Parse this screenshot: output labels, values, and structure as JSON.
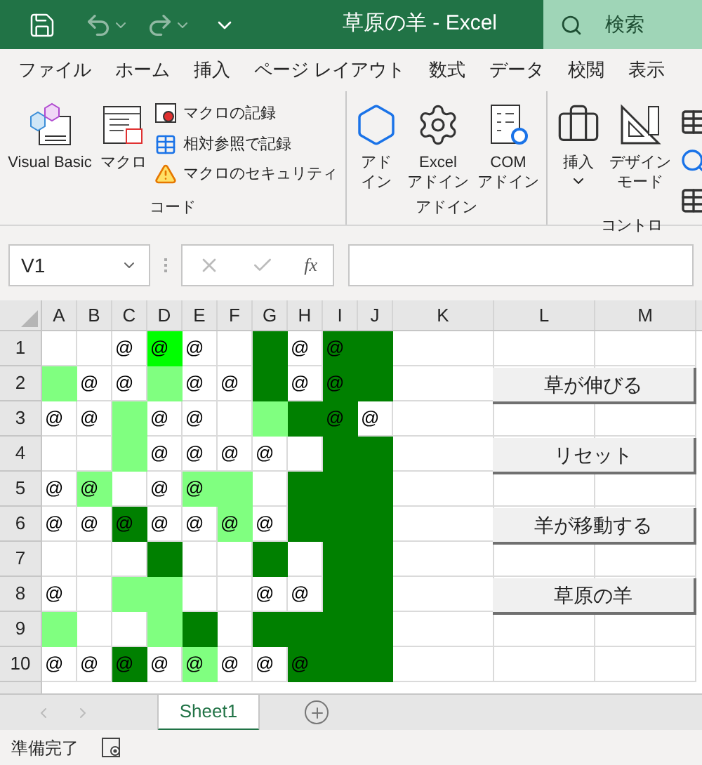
{
  "title_bar": {
    "title": "草原の羊  -  Excel",
    "search": "検索"
  },
  "menu_tabs": [
    "ファイル",
    "ホーム",
    "挿入",
    "ページ レイアウト",
    "数式",
    "データ",
    "校閲",
    "表示"
  ],
  "ribbon_groups": [
    {
      "label": "コード",
      "items": [
        {
          "kind": "large",
          "lines": [
            "Visual Basic"
          ]
        },
        {
          "kind": "large",
          "lines": [
            "マクロ"
          ]
        },
        {
          "kind": "small",
          "lines": [
            "マクロの記録"
          ]
        },
        {
          "kind": "small",
          "lines": [
            "相対参照で記録"
          ]
        },
        {
          "kind": "small",
          "lines": [
            "マクロのセキュリティ"
          ]
        }
      ]
    },
    {
      "label": "アドイン",
      "items": [
        {
          "kind": "large",
          "lines": [
            "アド",
            "イン"
          ]
        },
        {
          "kind": "large",
          "lines": [
            "Excel",
            "アドイン"
          ]
        },
        {
          "kind": "large",
          "lines": [
            "COM",
            "アドイン"
          ]
        }
      ]
    },
    {
      "label": "コントロ",
      "items": [
        {
          "kind": "dropdown",
          "lines": [
            "挿入"
          ]
        },
        {
          "kind": "large",
          "lines": [
            "デザイン",
            "モード"
          ]
        },
        {
          "kind": "stack"
        }
      ]
    }
  ],
  "formula_bar": {
    "name_box": "V1",
    "fx": "fx"
  },
  "columns": [
    "A",
    "B",
    "C",
    "D",
    "E",
    "F",
    "G",
    "H",
    "I",
    "J",
    "K",
    "L",
    "M"
  ],
  "rows": [
    {
      "label": "1",
      "cells": [
        {
          "color": "#ffffff"
        },
        {
          "color": "#ffffff"
        },
        {
          "color": "#ffffff",
          "text": "@"
        },
        {
          "color": "#00ff00",
          "text": "@"
        },
        {
          "color": "#ffffff",
          "text": "@"
        },
        {
          "color": "#ffffff"
        },
        {
          "color": "#008000"
        },
        {
          "color": "#ffffff",
          "text": "@"
        },
        {
          "color": "#008000",
          "text": "@"
        },
        {
          "color": "#008000"
        }
      ]
    },
    {
      "label": "2",
      "cells": [
        {
          "color": "#80ff80"
        },
        {
          "color": "#ffffff",
          "text": "@"
        },
        {
          "color": "#ffffff",
          "text": "@"
        },
        {
          "color": "#80ff80"
        },
        {
          "color": "#ffffff",
          "text": "@"
        },
        {
          "color": "#ffffff",
          "text": "@"
        },
        {
          "color": "#008000"
        },
        {
          "color": "#ffffff",
          "text": "@"
        },
        {
          "color": "#008000",
          "text": "@"
        },
        {
          "color": "#008000"
        }
      ]
    },
    {
      "label": "3",
      "cells": [
        {
          "color": "#ffffff",
          "text": "@"
        },
        {
          "color": "#ffffff",
          "text": "@"
        },
        {
          "color": "#80ff80"
        },
        {
          "color": "#ffffff",
          "text": "@"
        },
        {
          "color": "#ffffff",
          "text": "@"
        },
        {
          "color": "#ffffff"
        },
        {
          "color": "#80ff80"
        },
        {
          "color": "#008000"
        },
        {
          "color": "#008000",
          "text": "@"
        },
        {
          "color": "#ffffff",
          "text": "@"
        }
      ]
    },
    {
      "label": "4",
      "cells": [
        {
          "color": "#ffffff"
        },
        {
          "color": "#ffffff"
        },
        {
          "color": "#80ff80"
        },
        {
          "color": "#ffffff",
          "text": "@"
        },
        {
          "color": "#ffffff",
          "text": "@"
        },
        {
          "color": "#ffffff",
          "text": "@"
        },
        {
          "color": "#ffffff",
          "text": "@"
        },
        {
          "color": "#ffffff"
        },
        {
          "color": "#008000"
        },
        {
          "color": "#008000"
        }
      ]
    },
    {
      "label": "5",
      "cells": [
        {
          "color": "#ffffff",
          "text": "@"
        },
        {
          "color": "#80ff80",
          "text": "@"
        },
        {
          "color": "#ffffff"
        },
        {
          "color": "#ffffff",
          "text": "@"
        },
        {
          "color": "#80ff80",
          "text": "@"
        },
        {
          "color": "#80ff80"
        },
        {
          "color": "#ffffff"
        },
        {
          "color": "#008000"
        },
        {
          "color": "#008000"
        },
        {
          "color": "#008000"
        }
      ]
    },
    {
      "label": "6",
      "cells": [
        {
          "color": "#ffffff",
          "text": "@"
        },
        {
          "color": "#ffffff",
          "text": "@"
        },
        {
          "color": "#008000",
          "text": "@"
        },
        {
          "color": "#ffffff",
          "text": "@"
        },
        {
          "color": "#ffffff",
          "text": "@"
        },
        {
          "color": "#80ff80",
          "text": "@"
        },
        {
          "color": "#ffffff",
          "text": "@"
        },
        {
          "color": "#008000"
        },
        {
          "color": "#008000"
        },
        {
          "color": "#008000"
        }
      ]
    },
    {
      "label": "7",
      "cells": [
        {
          "color": "#ffffff"
        },
        {
          "color": "#ffffff"
        },
        {
          "color": "#ffffff"
        },
        {
          "color": "#008000"
        },
        {
          "color": "#ffffff"
        },
        {
          "color": "#ffffff"
        },
        {
          "color": "#008000"
        },
        {
          "color": "#ffffff"
        },
        {
          "color": "#008000"
        },
        {
          "color": "#008000"
        }
      ]
    },
    {
      "label": "8",
      "cells": [
        {
          "color": "#ffffff",
          "text": "@"
        },
        {
          "color": "#ffffff"
        },
        {
          "color": "#80ff80"
        },
        {
          "color": "#80ff80"
        },
        {
          "color": "#ffffff"
        },
        {
          "color": "#ffffff"
        },
        {
          "color": "#ffffff",
          "text": "@"
        },
        {
          "color": "#ffffff",
          "text": "@"
        },
        {
          "color": "#008000"
        },
        {
          "color": "#008000"
        }
      ]
    },
    {
      "label": "9",
      "cells": [
        {
          "color": "#80ff80"
        },
        {
          "color": "#ffffff"
        },
        {
          "color": "#ffffff"
        },
        {
          "color": "#80ff80"
        },
        {
          "color": "#008000"
        },
        {
          "color": "#ffffff"
        },
        {
          "color": "#008000"
        },
        {
          "color": "#008000"
        },
        {
          "color": "#008000"
        },
        {
          "color": "#008000"
        }
      ]
    },
    {
      "label": "10",
      "cells": [
        {
          "color": "#ffffff",
          "text": "@"
        },
        {
          "color": "#ffffff",
          "text": "@"
        },
        {
          "color": "#008000",
          "text": "@"
        },
        {
          "color": "#ffffff",
          "text": "@"
        },
        {
          "color": "#80ff80",
          "text": "@"
        },
        {
          "color": "#ffffff",
          "text": "@"
        },
        {
          "color": "#ffffff",
          "text": "@"
        },
        {
          "color": "#008000",
          "text": "@"
        },
        {
          "color": "#008000"
        },
        {
          "color": "#008000"
        }
      ]
    }
  ],
  "sheet_buttons": [
    {
      "label": "草が伸びる"
    },
    {
      "label": "リセット"
    },
    {
      "label": "羊が移動する"
    },
    {
      "label": "草原の羊"
    }
  ],
  "sheet_tabs": [
    {
      "label": "Sheet1",
      "selected": true
    }
  ],
  "status_bar": {
    "text": "準備完了"
  }
}
